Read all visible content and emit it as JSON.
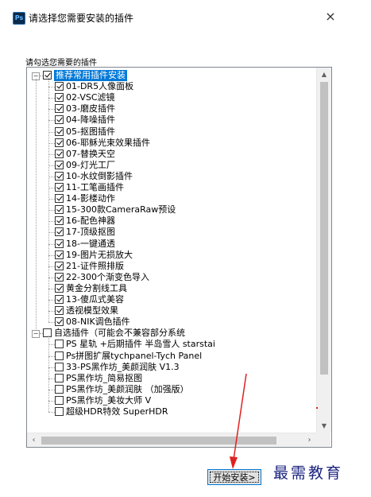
{
  "window": {
    "icon_text": "Ps",
    "title": "请选择您需要安装的插件",
    "close_glyph": "×"
  },
  "hint": "请勾选您需要的插件",
  "tree": {
    "groups": [
      {
        "label": "推荐常用插件安装",
        "checked": true,
        "selected": true,
        "items": [
          {
            "label": "01-DR5人像面板",
            "checked": true
          },
          {
            "label": "02-VSC滤镜",
            "checked": true
          },
          {
            "label": "03-磨皮插件",
            "checked": true
          },
          {
            "label": "04-降噪插件",
            "checked": true
          },
          {
            "label": "05-抠图插件",
            "checked": true
          },
          {
            "label": "06-耶稣光束效果插件",
            "checked": true
          },
          {
            "label": "07-替换天空",
            "checked": true
          },
          {
            "label": "09-灯光工厂",
            "checked": true
          },
          {
            "label": "10-水纹倒影插件",
            "checked": true
          },
          {
            "label": "11-工笔画插件",
            "checked": true
          },
          {
            "label": "14-影楼动作",
            "checked": true
          },
          {
            "label": "15-300款CameraRaw预设",
            "checked": true
          },
          {
            "label": "16-配色神器",
            "checked": true
          },
          {
            "label": "17-顶级抠图",
            "checked": true
          },
          {
            "label": "18-一键通透",
            "checked": true
          },
          {
            "label": "19-图片无损放大",
            "checked": true
          },
          {
            "label": "21-证件照排版",
            "checked": true
          },
          {
            "label": "22-300个渐变色导入",
            "checked": true
          },
          {
            "label": "黄金分割线工具",
            "checked": true
          },
          {
            "label": "13-傻瓜式美容",
            "checked": true
          },
          {
            "label": "透视模型效果",
            "checked": true
          },
          {
            "label": "08-NIK调色插件",
            "checked": true
          }
        ]
      },
      {
        "label": "自选插件（可能会不兼容部分系统",
        "checked": false,
        "selected": false,
        "items": [
          {
            "label": "PS 星轨 +后期插件 半岛雪人 starstai",
            "checked": false
          },
          {
            "label": "Ps拼图扩展tychpanel-Tych Panel",
            "checked": false
          },
          {
            "label": "33-PS黑作坊_美颜润肤 V1.3",
            "checked": false
          },
          {
            "label": "PS黑作坊_简易抠图",
            "checked": false
          },
          {
            "label": "PS黑作坊_美颜润肤 （加强版）",
            "checked": false
          },
          {
            "label": "PS黑作坊_美妆大师 V",
            "checked": false
          },
          {
            "label": "超级HDR特效 SuperHDR",
            "checked": false
          }
        ]
      }
    ],
    "expander_glyph": "−"
  },
  "scrollbar": {
    "up": "▲",
    "down": "▼",
    "left": "‹",
    "right": "›"
  },
  "install_button": "开始安装>",
  "watermark": "最需教育",
  "colors": {
    "selection": "#0078d7",
    "annotation_arrow": "#e02020",
    "watermark": "#1a237e"
  }
}
